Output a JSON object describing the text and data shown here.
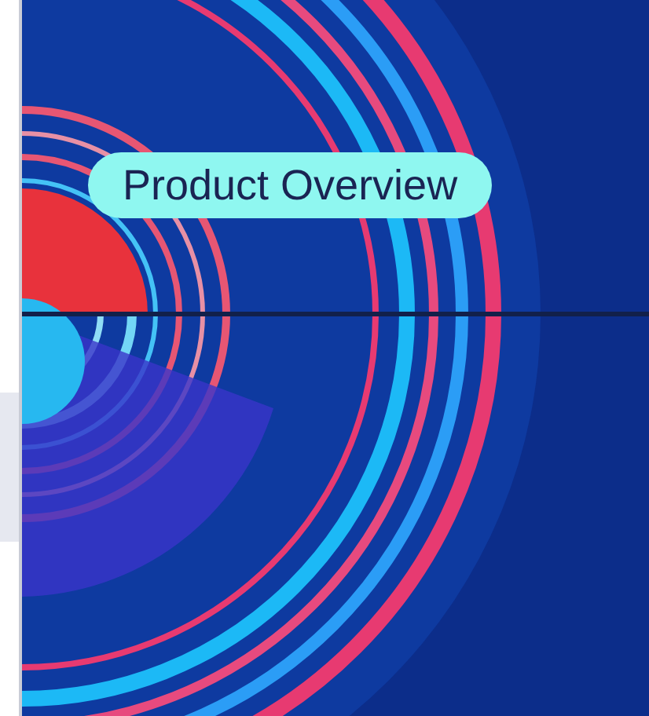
{
  "banner": {
    "label": "Product Overview"
  }
}
